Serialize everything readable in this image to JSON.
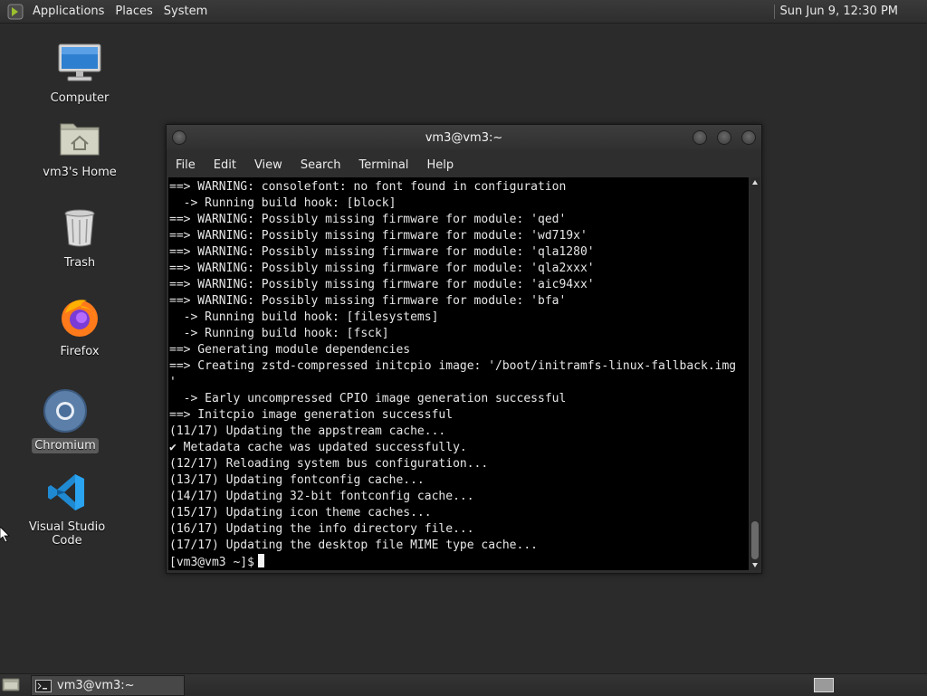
{
  "top_panel": {
    "menus": [
      "Applications",
      "Places",
      "System"
    ],
    "clock": "Sun Jun  9, 12:30 PM"
  },
  "desktop": {
    "icons": [
      {
        "label": "Computer",
        "icon": "computer-icon"
      },
      {
        "label": "vm3's Home",
        "icon": "home-folder-icon"
      },
      {
        "label": "Trash",
        "icon": "trash-icon"
      },
      {
        "label": "Firefox",
        "icon": "firefox-icon"
      },
      {
        "label": "Chromium",
        "icon": "chromium-icon",
        "selected": true
      },
      {
        "label": "Visual Studio Code",
        "icon": "vscode-icon"
      }
    ]
  },
  "terminal": {
    "title": "vm3@vm3:~",
    "menu": [
      "File",
      "Edit",
      "View",
      "Search",
      "Terminal",
      "Help"
    ],
    "lines": [
      "==> WARNING: consolefont: no font found in configuration",
      "  -> Running build hook: [block]",
      "==> WARNING: Possibly missing firmware for module: 'qed'",
      "==> WARNING: Possibly missing firmware for module: 'wd719x'",
      "==> WARNING: Possibly missing firmware for module: 'qla1280'",
      "==> WARNING: Possibly missing firmware for module: 'qla2xxx'",
      "==> WARNING: Possibly missing firmware for module: 'aic94xx'",
      "==> WARNING: Possibly missing firmware for module: 'bfa'",
      "  -> Running build hook: [filesystems]",
      "  -> Running build hook: [fsck]",
      "==> Generating module dependencies",
      "==> Creating zstd-compressed initcpio image: '/boot/initramfs-linux-fallback.img",
      "'",
      "  -> Early uncompressed CPIO image generation successful",
      "==> Initcpio image generation successful",
      "(11/17) Updating the appstream cache...",
      "✔ Metadata cache was updated successfully.",
      "(12/17) Reloading system bus configuration...",
      "(13/17) Updating fontconfig cache...",
      "(14/17) Updating 32-bit fontconfig cache...",
      "(15/17) Updating icon theme caches...",
      "(16/17) Updating the info directory file...",
      "(17/17) Updating the desktop file MIME type cache..."
    ],
    "prompt": "[vm3@vm3 ~]$"
  },
  "taskbar": {
    "window_button": "vm3@vm3:~"
  }
}
